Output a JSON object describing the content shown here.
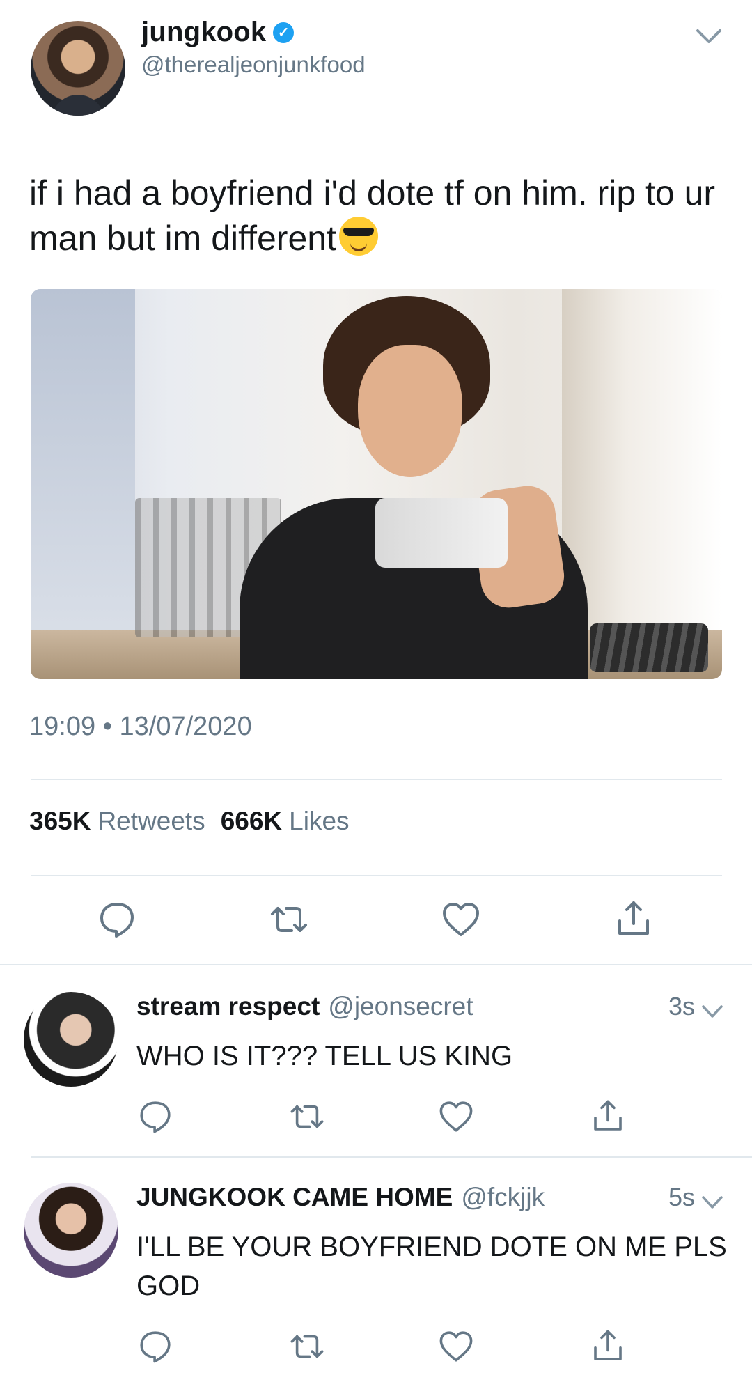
{
  "tweet": {
    "display_name": "jungkook",
    "handle": "@therealjeonjunkfood",
    "text": "if i had a boyfriend i'd dote tf on him. rip to ur man but im different",
    "emoji": "smiling-face-with-sunglasses",
    "timestamp": "19:09 • 13/07/2020",
    "retweet_count": "365K",
    "retweet_label": "Retweets",
    "like_count": "666K",
    "like_label": "Likes"
  },
  "replies": [
    {
      "display_name": "stream respect",
      "handle": "@jeonsecret",
      "time": "3s",
      "text": "WHO IS IT??? TELL US KING"
    },
    {
      "display_name": "JUNGKOOK CAME HOME",
      "handle": "@fckjjk",
      "time": "5s",
      "text": "I'LL BE YOUR BOYFRIEND DOTE ON ME PLS GOD"
    }
  ],
  "colors": {
    "accent": "#1da1f2",
    "text": "#14171a",
    "muted": "#657786",
    "divider": "#e1e8ed"
  },
  "icons": [
    "verified-badge-icon",
    "chevron-down-icon",
    "reply-icon",
    "retweet-icon",
    "like-icon",
    "share-icon"
  ]
}
